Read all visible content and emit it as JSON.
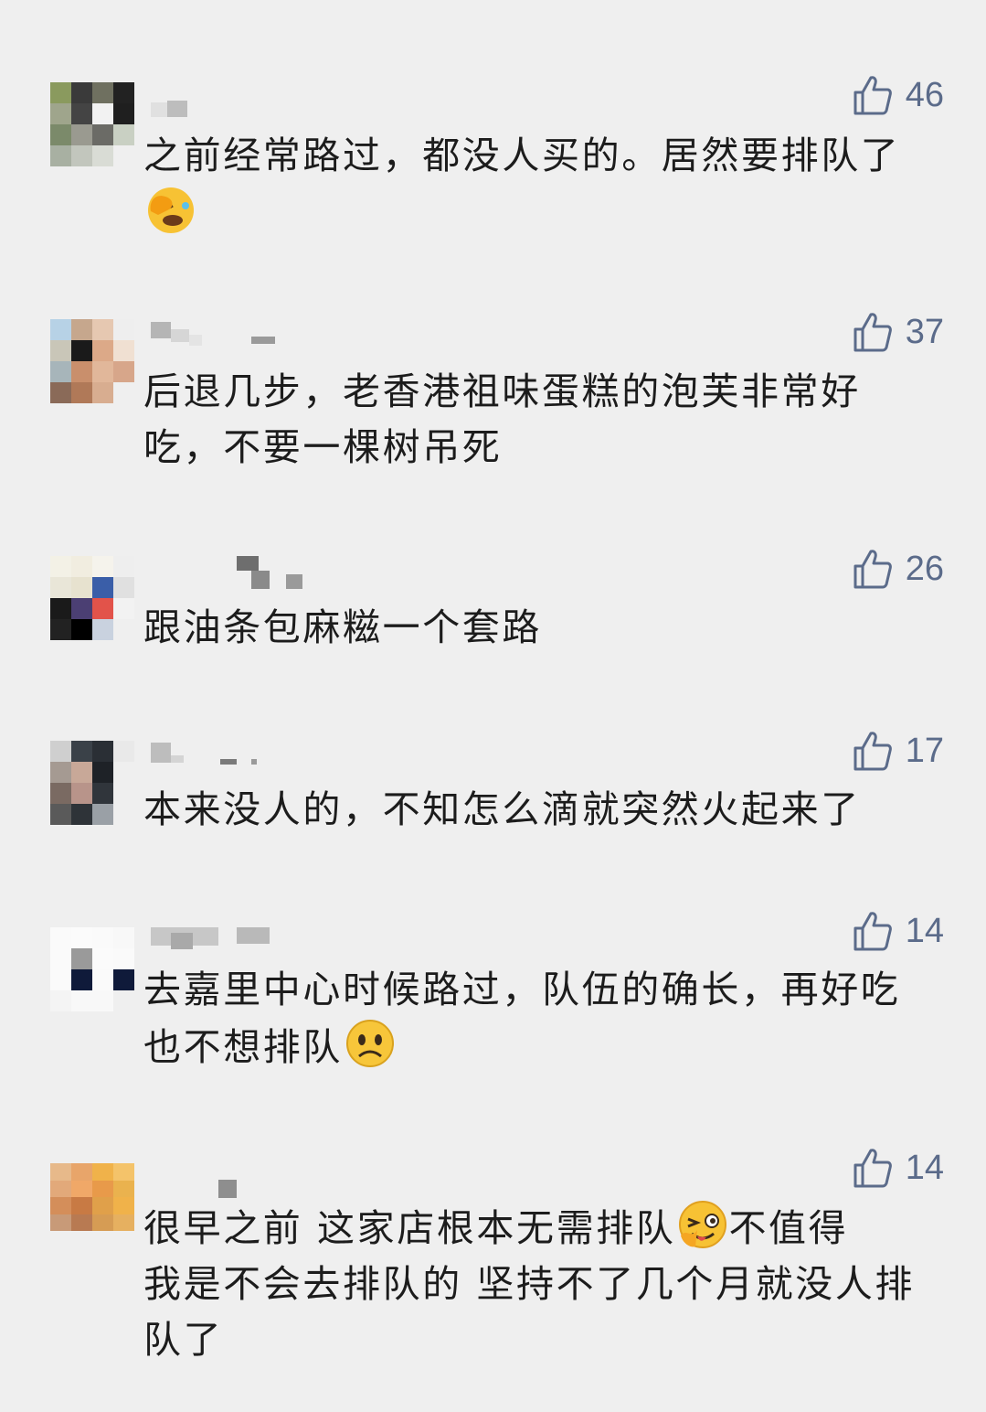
{
  "comments": [
    {
      "likes": "46",
      "text_before": "之前经常路过，都没人买的。居然要排队了",
      "emoji": "facepalm-emoji",
      "text_after": ""
    },
    {
      "likes": "37",
      "text_before": "后退几步，老香港祖味蛋糕的泡芙非常好吃，不要一棵树吊死",
      "emoji": "",
      "text_after": ""
    },
    {
      "likes": "26",
      "text_before": "跟油条包麻糍一个套路",
      "emoji": "",
      "text_after": ""
    },
    {
      "likes": "17",
      "text_before": "本来没人的，不知怎么滴就突然火起来了",
      "emoji": "",
      "text_after": ""
    },
    {
      "likes": "14",
      "text_before": "去嘉里中心时候路过，队伍的确长，再好吃也不想排队",
      "emoji": "frown-emoji",
      "text_after": ""
    },
    {
      "likes": "14",
      "text_before": "很早之前 这家店根本无需排队",
      "emoji": "wink-tongue-emoji",
      "text_after": "不值得\n我是不会去排队的 坚持不了几个月就没人排队了"
    }
  ],
  "icons": {
    "like": "thumbs-up-icon"
  },
  "colors": {
    "background": "#efefef",
    "like_color": "#5b6b8a",
    "text_color": "#1c1c1c"
  }
}
